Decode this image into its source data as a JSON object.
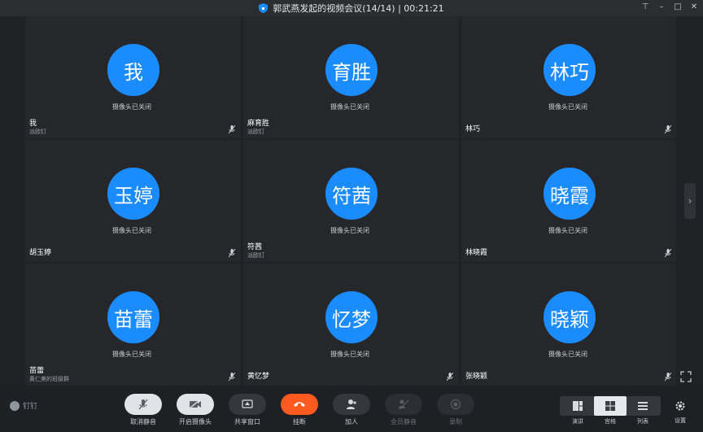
{
  "window": {
    "title": "郭武燕发起的视频会议(14/14) | 00:21:21"
  },
  "participants": [
    {
      "avatar": "我",
      "name": "我",
      "sub": "派欧钉",
      "camera": "摄像头已关闭",
      "muted": true
    },
    {
      "avatar": "育胜",
      "name": "麻育胜",
      "sub": "派欧钉",
      "camera": "摄像头已关闭",
      "muted": false
    },
    {
      "avatar": "林巧",
      "name": "林巧",
      "sub": "",
      "camera": "摄像头已关闭",
      "muted": true
    },
    {
      "avatar": "玉婷",
      "name": "胡玉婷",
      "sub": "",
      "camera": "摄像头已关闭",
      "muted": true
    },
    {
      "avatar": "符茜",
      "name": "符茜",
      "sub": "派欧钉",
      "camera": "摄像头已关闭",
      "muted": false
    },
    {
      "avatar": "晓霞",
      "name": "林晓霞",
      "sub": "",
      "camera": "摄像头已关闭",
      "muted": true
    },
    {
      "avatar": "苗蕾",
      "name": "苗蕾",
      "sub": "黄仁美的班级群",
      "camera": "摄像头已关闭",
      "muted": true
    },
    {
      "avatar": "忆梦",
      "name": "黄忆梦",
      "sub": "",
      "camera": "摄像头已关闭",
      "muted": true
    },
    {
      "avatar": "晓颖",
      "name": "张晓颖",
      "sub": "",
      "camera": "摄像头已关闭",
      "muted": true
    }
  ],
  "brand": {
    "name": "钉钉"
  },
  "toolbar": {
    "unmute": "取消静音",
    "camera": "开启摄像头",
    "share": "共享窗口",
    "hangup": "挂断",
    "join": "加人",
    "mute_all": "全员静音",
    "record": "录制"
  },
  "layouts": {
    "speaker": "演讲",
    "grid": "宫格",
    "list": "列表"
  },
  "settings_label": "设置",
  "colors": {
    "avatar_blue": "#1a8cff",
    "hangup_red": "#ff5a1f",
    "background": "#1f2125",
    "tile": "#25272b"
  }
}
